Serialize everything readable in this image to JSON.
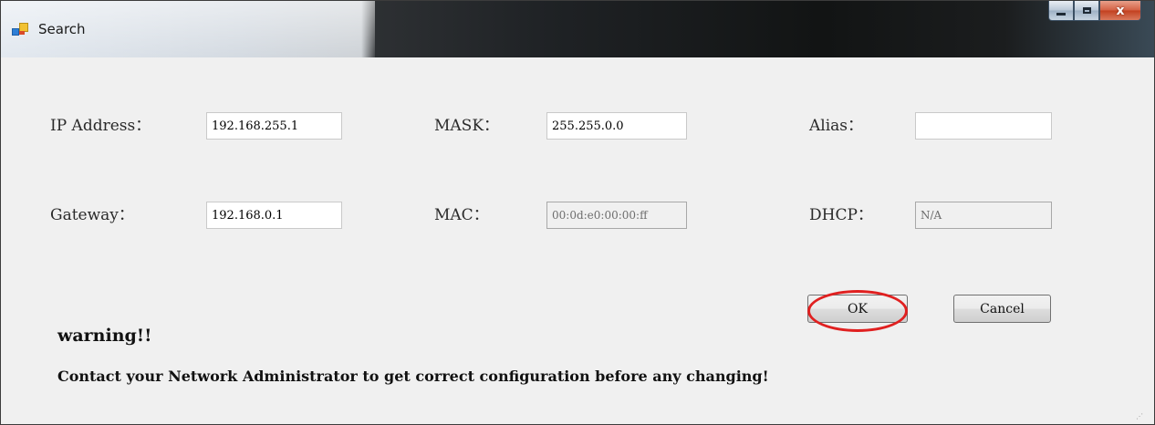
{
  "window": {
    "title": "Search",
    "app_icon": "app-window-icon",
    "caption": {
      "minimize_icon": "minimize-icon",
      "maximize_icon": "maximize-icon",
      "close_icon": "close-icon",
      "close_glyph": "x"
    }
  },
  "form": {
    "ip_address": {
      "label": "IP Address：",
      "value": "192.168.255.1"
    },
    "mask": {
      "label": "MASK：",
      "value": "255.255.0.0"
    },
    "alias": {
      "label": "Alias：",
      "value": ""
    },
    "gateway": {
      "label": "Gateway：",
      "value": "192.168.0.1"
    },
    "mac": {
      "label": "MAC：",
      "value": "00:0d:e0:00:00:ff"
    },
    "dhcp": {
      "label": "DHCP：",
      "value": "N/A"
    }
  },
  "buttons": {
    "ok_label": "OK",
    "cancel_label": "Cancel"
  },
  "warning": {
    "title": "warning!!",
    "message": "Contact your Network Administrator to get correct configuration before any changing!"
  },
  "colors": {
    "highlight_ring": "#e02020",
    "window_background": "#f0f0f0"
  }
}
